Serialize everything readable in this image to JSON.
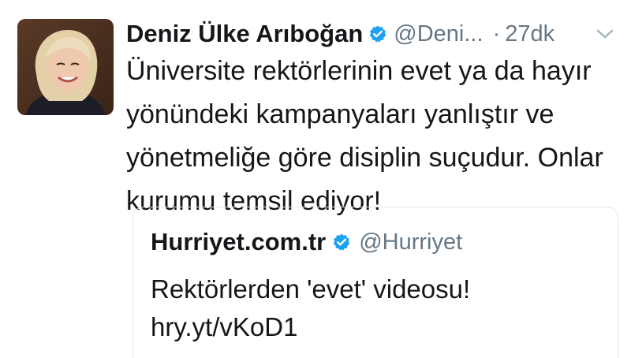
{
  "tweet": {
    "display_name": "Deniz Ülke Arıboğan",
    "handle": "@Deni...",
    "separator": "·",
    "time": "27dk",
    "text": "Üniversite rektörlerinin evet ya da hayır yönündeki kampanyaları yanlıştır ve yönetmeliğe göre disiplin suçudur. Onlar kurumu temsil ediyor!",
    "avatar_icon": "profile-photo",
    "verified_icon": "verified-badge-icon"
  },
  "quoted_tweet": {
    "display_name": "Hurriyet.com.tr",
    "handle": "@Hurriyet",
    "text_line1": "Rektörlerden 'evet' videosu!",
    "text_line2": "hry.yt/vKoD1",
    "verified_icon": "verified-badge-icon"
  },
  "colors": {
    "verified": "#1da1f2",
    "secondary_text": "#657786",
    "primary_text": "#14171a",
    "border": "#e1e8ed"
  }
}
